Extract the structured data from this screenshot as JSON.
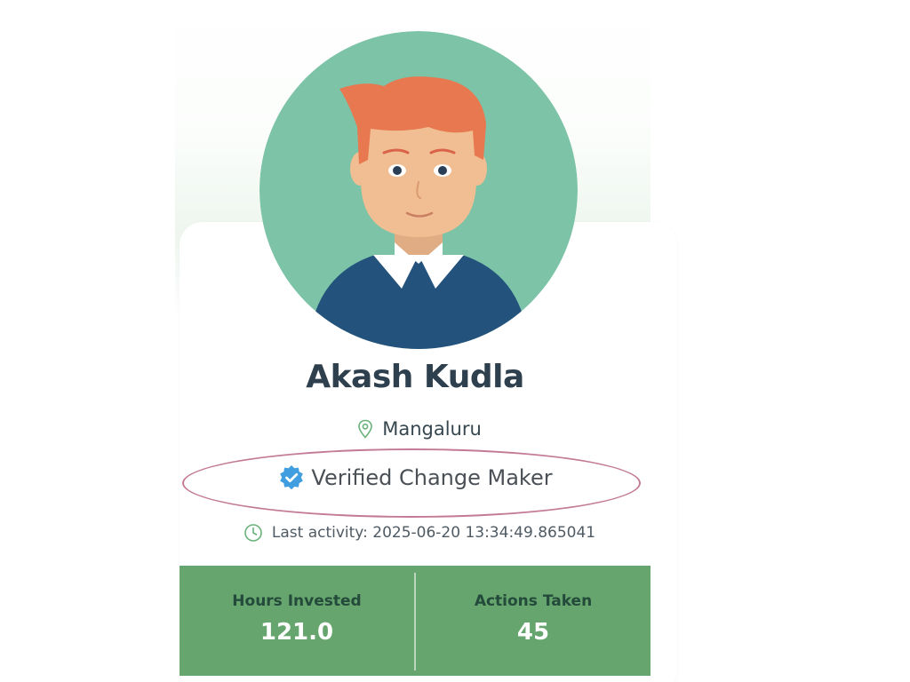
{
  "profile": {
    "name": "Akash Kudla",
    "location": "Mangaluru",
    "badge": "Verified Change Maker",
    "last_activity": "Last activity: 2025-06-20 13:34:49.865041"
  },
  "stats": [
    {
      "label": "Hours Invested",
      "value": "121.0"
    },
    {
      "label": "Actions Taken",
      "value": "45"
    }
  ],
  "icons": {
    "location": "map-pin-icon",
    "verified": "verified-badge-icon",
    "activity": "clock-icon"
  },
  "colors": {
    "avatar_background": "#7cc3a8",
    "stats_background": "#66a56d",
    "verified_blue": "#3f9de0",
    "highlight_ellipse": "#c37a96",
    "name_text": "#2e3f4e"
  }
}
